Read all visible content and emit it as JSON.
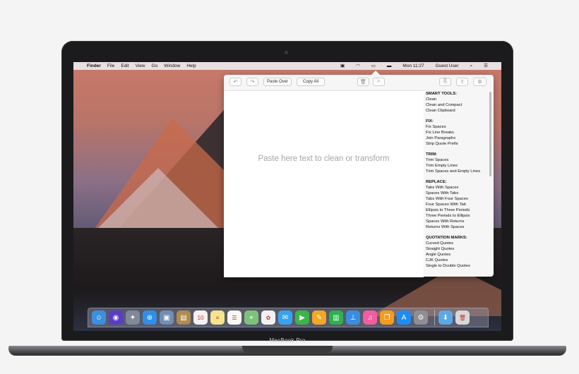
{
  "menubar": {
    "apple": "",
    "items": [
      "Finder",
      "File",
      "Edit",
      "View",
      "Go",
      "Window",
      "Help"
    ],
    "clock": "Mon 11:27",
    "user": "Guest User",
    "status_icons": [
      "clipboard-icon",
      "wifi-icon",
      "airplay-icon",
      "battery-icon",
      "search-icon",
      "list-icon"
    ]
  },
  "popover": {
    "toolbar": {
      "undo_icon": "↶",
      "redo_icon": "↷",
      "paste_over": "Paste Over",
      "copy_all": "Copy All",
      "trash_icon": "🗑",
      "search_icon": "⌕",
      "export_icon": "⎘",
      "share_icon": "⇪",
      "settings_icon": "⚙"
    },
    "placeholder": "Paste here text to clean or transform",
    "sidebar": [
      {
        "heading": "SMART TOOLS:",
        "items": [
          "Clean",
          "Clean and Compact",
          "Clean Clipboard"
        ]
      },
      {
        "heading": "FIX:",
        "items": [
          "Fix Spaces",
          "Fix Line Breaks",
          "Join Paragraphs",
          "Strip Quote Prefix"
        ]
      },
      {
        "heading": "TRIM:",
        "items": [
          "Trim Spaces",
          "Trim Empty Lines",
          "Trim Spaces and Empty Lines"
        ]
      },
      {
        "heading": "REPLACE:",
        "items": [
          "Tabs With Spaces",
          "Spaces With Tabs",
          "Tabs With Four Spaces",
          "Four Spaces With Tab",
          "Ellipsis to Three Periods",
          "Three Periods to Ellipsis",
          "Spaces With Returns",
          "Returns With Spaces"
        ]
      },
      {
        "heading": "QUOTATION MARKS:",
        "items": [
          "Curved Quotes",
          "Straight Quotes",
          "Angle Quotes",
          "CJK Quotes",
          "Single to Double Quotes"
        ]
      }
    ]
  },
  "dock": {
    "apps": [
      {
        "name": "finder-icon",
        "glyph": "☺",
        "color": "#3b8fe0"
      },
      {
        "name": "siri-icon",
        "glyph": "◉",
        "color": "#5a3cc9"
      },
      {
        "name": "launchpad-icon",
        "glyph": "✦",
        "color": "#7f8a99"
      },
      {
        "name": "safari-icon",
        "glyph": "⊕",
        "color": "#2f8fe8"
      },
      {
        "name": "photo-browser-icon",
        "glyph": "▣",
        "color": "#6f8fb4"
      },
      {
        "name": "contacts-icon",
        "glyph": "▤",
        "color": "#b08a4e"
      },
      {
        "name": "calendar-icon",
        "glyph": "10",
        "color": "#f2f2f2"
      },
      {
        "name": "notes-icon",
        "glyph": "≡",
        "color": "#f4e48b"
      },
      {
        "name": "reminders-icon",
        "glyph": "☰",
        "color": "#f7f7f7"
      },
      {
        "name": "maps-icon",
        "glyph": "⌖",
        "color": "#7cc37a"
      },
      {
        "name": "photos-icon",
        "glyph": "✿",
        "color": "#f1f1f1"
      },
      {
        "name": "messages-icon",
        "glyph": "✉",
        "color": "#37a2f2"
      },
      {
        "name": "facetime-icon",
        "glyph": "▶",
        "color": "#39b54a"
      },
      {
        "name": "pages-icon",
        "glyph": "✎",
        "color": "#f5a623"
      },
      {
        "name": "numbers-icon",
        "glyph": "▥",
        "color": "#2bb24c"
      },
      {
        "name": "keynote-icon",
        "glyph": "⊥",
        "color": "#3a8de0"
      },
      {
        "name": "itunes-icon",
        "glyph": "♫",
        "color": "#f45ca0"
      },
      {
        "name": "ibooks-icon",
        "glyph": "❐",
        "color": "#f39c1e"
      },
      {
        "name": "app-store-icon",
        "glyph": "A",
        "color": "#1e8df2"
      },
      {
        "name": "system-preferences-icon",
        "glyph": "⚙",
        "color": "#8e8e93"
      }
    ],
    "trailing": [
      {
        "name": "downloads-folder-icon",
        "glyph": "⬇",
        "color": "#5aa9e6"
      },
      {
        "name": "trash-icon",
        "glyph": "🗑",
        "color": "#d7d7dc"
      }
    ]
  },
  "device": {
    "label": "MacBook Pro"
  }
}
